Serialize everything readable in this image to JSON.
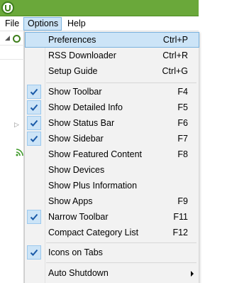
{
  "menubar": {
    "file": "File",
    "options": "Options",
    "help": "Help"
  },
  "options_menu": {
    "items": [
      {
        "label": "Preferences",
        "shortcut": "Ctrl+P",
        "checked": false,
        "highlighted": true
      },
      {
        "label": "RSS Downloader",
        "shortcut": "Ctrl+R",
        "checked": false
      },
      {
        "label": "Setup Guide",
        "shortcut": "Ctrl+G",
        "checked": false
      },
      {
        "label": "Show Toolbar",
        "shortcut": "F4",
        "checked": true
      },
      {
        "label": "Show Detailed Info",
        "shortcut": "F5",
        "checked": true
      },
      {
        "label": "Show Status Bar",
        "shortcut": "F6",
        "checked": true
      },
      {
        "label": "Show Sidebar",
        "shortcut": "F7",
        "checked": true
      },
      {
        "label": "Show Featured Content",
        "shortcut": "F8",
        "checked": false
      },
      {
        "label": "Show Devices",
        "shortcut": "",
        "checked": false
      },
      {
        "label": "Show Plus Information",
        "shortcut": "",
        "checked": false
      },
      {
        "label": "Show Apps",
        "shortcut": "F9",
        "checked": false
      },
      {
        "label": "Narrow Toolbar",
        "shortcut": "F11",
        "checked": true
      },
      {
        "label": "Compact Category List",
        "shortcut": "F12",
        "checked": false
      },
      {
        "label": "Icons on Tabs",
        "shortcut": "",
        "checked": true
      },
      {
        "label": "Auto Shutdown",
        "shortcut": "",
        "checked": false,
        "submenu": true
      }
    ]
  },
  "colors": {
    "title_bar": "#6aa83a",
    "highlight": "#cce4f7",
    "highlight_border": "#7ab2dd",
    "menu_background": "#f2f2f2"
  }
}
